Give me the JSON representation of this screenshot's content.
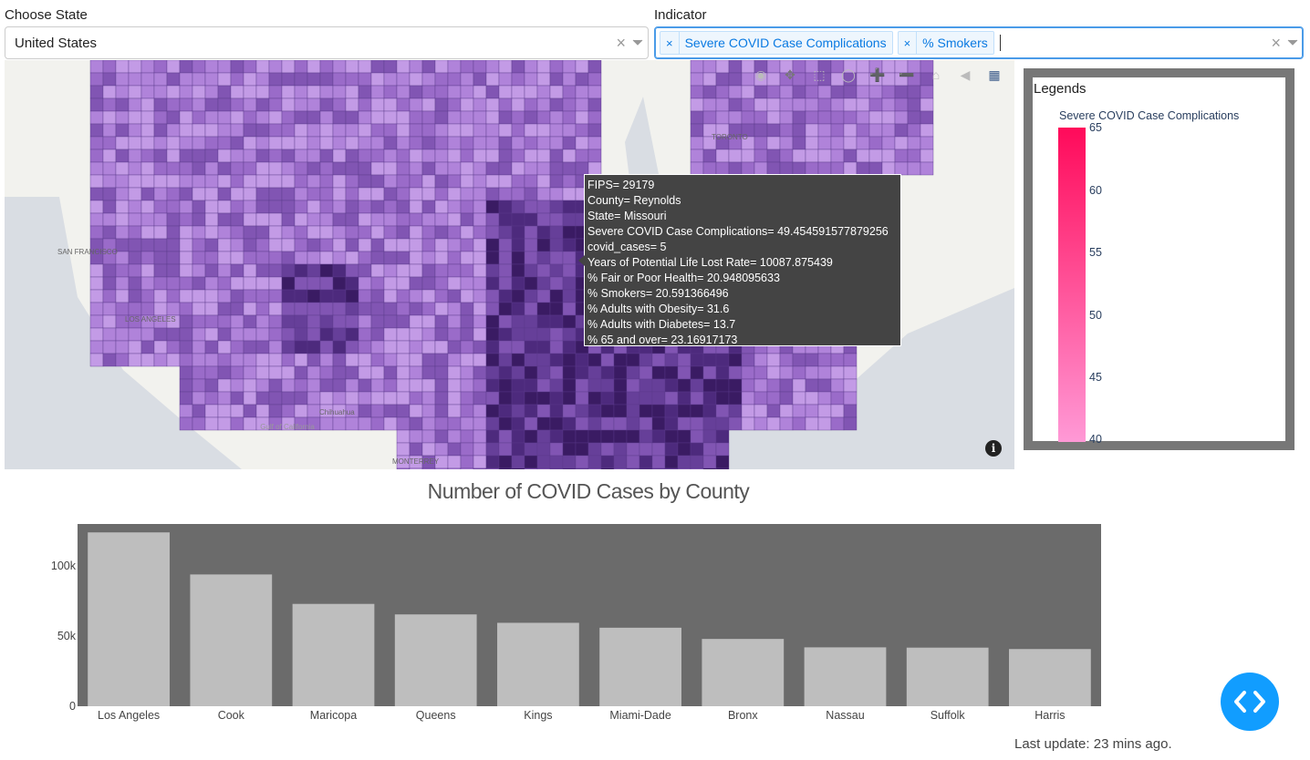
{
  "state_filter": {
    "label": "Choose State",
    "value": "United States",
    "clear_icon": "×",
    "arrow_icon": "chevron-down-icon"
  },
  "indicator_filter": {
    "label": "Indicator",
    "tags": [
      {
        "remove": "×",
        "label": "Severe COVID Case Complications"
      },
      {
        "remove": "×",
        "label": "% Smokers"
      }
    ],
    "clear_icon": "×",
    "arrow_icon": "chevron-down-icon"
  },
  "map": {
    "place_labels": [
      "TORONTO",
      "SAN FRANCISCO",
      "LOS ANGELES",
      "MONTERREY",
      "Chihuahua",
      "Gulf of California"
    ],
    "modebar": [
      "camera-icon",
      "pan-icon",
      "box-select-icon",
      "lasso-icon",
      "zoom-in-icon",
      "zoom-out-icon",
      "home-icon",
      "reset-icon",
      "plotly-logo-icon"
    ],
    "info_icon": "i"
  },
  "tooltip": {
    "lines": [
      "FIPS= 29179",
      "County= Reynolds",
      "State= Missouri",
      "Severe COVID Case Complications= 49.454591577879256",
      "covid_cases= 5",
      "Years of Potential Life Lost Rate= 10087.875439",
      "% Fair or Poor Health= 20.948095633",
      "% Smokers= 20.591366496",
      "% Adults with Obesity= 31.6",
      "% Adults with Diabetes= 13.7",
      "% 65 and over= 23.16917173"
    ]
  },
  "legend": {
    "title": "Legends",
    "colorbar_title": "Severe COVID Case Complications",
    "ticks": [
      "65",
      "60",
      "55",
      "50",
      "45",
      "40"
    ],
    "colors": {
      "high": "#ff0a5a",
      "low": "#ff99d6"
    }
  },
  "chart_data": {
    "type": "bar",
    "title": "Number of COVID Cases by County",
    "categories": [
      "Los Angeles",
      "Cook",
      "Maricopa",
      "Queens",
      "Kings",
      "Miami-Dade",
      "Bronx",
      "Nassau",
      "Suffolk",
      "Harris"
    ],
    "values": [
      124000,
      94000,
      73000,
      65500,
      59500,
      56000,
      48000,
      42000,
      41800,
      40800
    ],
    "ytick_labels": [
      "0",
      "50k",
      "100k"
    ],
    "ytick_values": [
      0,
      50000,
      100000
    ],
    "ylim": [
      0,
      130000
    ],
    "colors": {
      "plot_bg": "#6b6b6b",
      "bar": "#bebebe"
    }
  },
  "footer": {
    "text": "Last update: 23 mins ago."
  },
  "fab": {
    "icon": "code-icon"
  }
}
